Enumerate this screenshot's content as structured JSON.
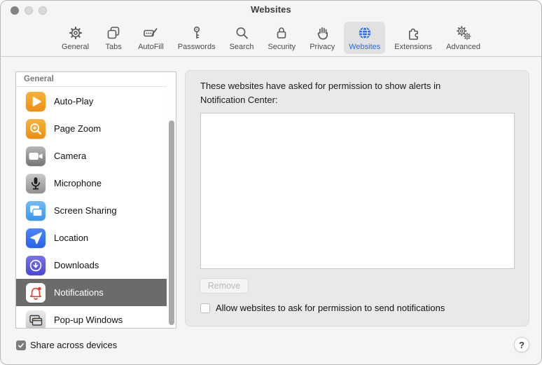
{
  "window": {
    "title": "Websites"
  },
  "toolbar": {
    "items": [
      {
        "id": "general",
        "label": "General",
        "icon": "gear-icon",
        "selected": false
      },
      {
        "id": "tabs",
        "label": "Tabs",
        "icon": "tabs-icon",
        "selected": false
      },
      {
        "id": "autofill",
        "label": "AutoFill",
        "icon": "autofill-icon",
        "selected": false
      },
      {
        "id": "passwords",
        "label": "Passwords",
        "icon": "key-icon",
        "selected": false
      },
      {
        "id": "search",
        "label": "Search",
        "icon": "search-icon",
        "selected": false
      },
      {
        "id": "security",
        "label": "Security",
        "icon": "lock-icon",
        "selected": false
      },
      {
        "id": "privacy",
        "label": "Privacy",
        "icon": "hand-icon",
        "selected": false
      },
      {
        "id": "websites",
        "label": "Websites",
        "icon": "globe-icon",
        "selected": true
      },
      {
        "id": "extensions",
        "label": "Extensions",
        "icon": "puzzle-icon",
        "selected": false
      },
      {
        "id": "advanced",
        "label": "Advanced",
        "icon": "gears-icon",
        "selected": false
      }
    ]
  },
  "sidebar": {
    "header": "General",
    "items": [
      {
        "id": "auto-play",
        "label": "Auto-Play",
        "icon": "auto-play-icon",
        "selected": false
      },
      {
        "id": "page-zoom",
        "label": "Page Zoom",
        "icon": "page-zoom-icon",
        "selected": false
      },
      {
        "id": "camera",
        "label": "Camera",
        "icon": "camera-icon",
        "selected": false
      },
      {
        "id": "microphone",
        "label": "Microphone",
        "icon": "microphone-icon",
        "selected": false
      },
      {
        "id": "screen-sharing",
        "label": "Screen Sharing",
        "icon": "screen-sharing-icon",
        "selected": false
      },
      {
        "id": "location",
        "label": "Location",
        "icon": "location-icon",
        "selected": false
      },
      {
        "id": "downloads",
        "label": "Downloads",
        "icon": "downloads-icon",
        "selected": false
      },
      {
        "id": "notifications",
        "label": "Notifications",
        "icon": "notifications-icon",
        "selected": true
      },
      {
        "id": "popup-windows",
        "label": "Pop-up Windows",
        "icon": "popup-windows-icon",
        "selected": false
      }
    ]
  },
  "panel": {
    "description": "These websites have asked for permission to show alerts in Notification Center:",
    "website_list_items": [],
    "remove_button_label": "Remove",
    "remove_button_enabled": false,
    "allow_checkbox_label": "Allow websites to ask for permission to send notifications",
    "allow_checkbox_checked": false
  },
  "footer": {
    "share_checkbox_label": "Share across devices",
    "share_checkbox_checked": true,
    "help_button_label": "?"
  },
  "colors": {
    "accent_blue": "#2e6be5",
    "selected_row_gray": "#6b6b6b",
    "notification_red": "#e03e36",
    "window_background": "#f5f5f5",
    "panel_background": "#e9e9e9"
  }
}
